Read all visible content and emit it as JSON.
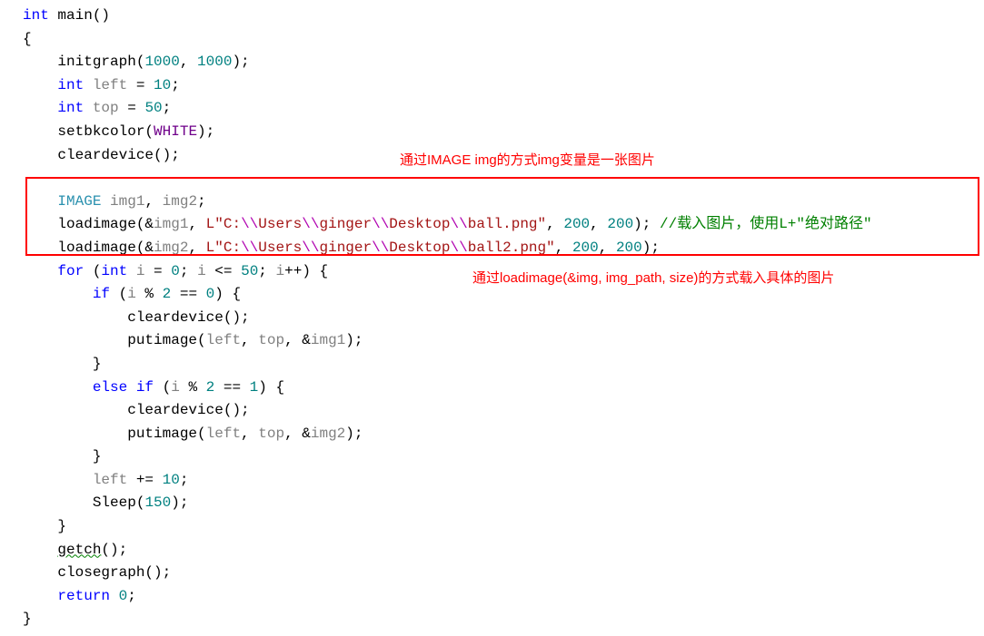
{
  "annotations": {
    "top": "通过IMAGE img的方式img变量是一张图片",
    "bottom": "通过loadimage(&img, img_path, size)的方式载入具体的图片"
  },
  "code": {
    "l1_kw_int": "int",
    "l1_main": " main()",
    "l2_brace": "{",
    "l3_fn": "initgraph",
    "l3_args_a": "(",
    "l3_num1": "1000",
    "l3_comma": ", ",
    "l3_num2": "1000",
    "l3_end": ");",
    "l4_kw": "int",
    "l4_sp": " ",
    "l4_var": "left",
    "l4_eq": " = ",
    "l4_num": "10",
    "l4_end": ";",
    "l5_kw": "int",
    "l5_sp": " ",
    "l5_var": "top",
    "l5_eq": " = ",
    "l5_num": "50",
    "l5_end": ";",
    "l6_fn": "setbkcolor",
    "l6_open": "(",
    "l6_macro": "WHITE",
    "l6_end": ");",
    "l7_fn": "cleardevice",
    "l7_end": "();",
    "l9_type": "IMAGE",
    "l9_sp": " ",
    "l9_v1": "img1",
    "l9_comma": ", ",
    "l9_v2": "img2",
    "l9_end": ";",
    "l10_fn": "loadimage",
    "l10_open": "(&",
    "l10_var": "img1",
    "l10_comma1": ", ",
    "l10_L": "L",
    "l10_q1": "\"C:",
    "l10_esc1": "\\\\",
    "l10_s2": "Users",
    "l10_esc2": "\\\\",
    "l10_s3": "ginger",
    "l10_esc3": "\\\\",
    "l10_s4": "Desktop",
    "l10_esc4": "\\\\",
    "l10_s5": "ball.png\"",
    "l10_comma2": ", ",
    "l10_n1": "200",
    "l10_comma3": ", ",
    "l10_n2": "200",
    "l10_end": "); ",
    "l10_comment": "//载入图片，使用L+\"绝对路径\"",
    "l11_fn": "loadimage",
    "l11_open": "(&",
    "l11_var": "img2",
    "l11_comma1": ", ",
    "l11_L": "L",
    "l11_q1": "\"C:",
    "l11_esc1": "\\\\",
    "l11_s2": "Users",
    "l11_esc2": "\\\\",
    "l11_s3": "ginger",
    "l11_esc3": "\\\\",
    "l11_s4": "Desktop",
    "l11_esc4": "\\\\",
    "l11_s5": "ball2.png\"",
    "l11_comma2": ", ",
    "l11_n1": "200",
    "l11_comma3": ", ",
    "l11_n2": "200",
    "l11_end": ");",
    "l12_for": "for",
    "l12_sp": " (",
    "l12_int": "int",
    "l12_sp2": " ",
    "l12_i": "i",
    "l12_eq": " = ",
    "l12_z": "0",
    "l12_semi": "; ",
    "l12_i2": "i",
    "l12_le": " <= ",
    "l12_50": "50",
    "l12_semi2": "; ",
    "l12_i3": "i",
    "l12_inc": "++) {",
    "l13_if": "if",
    "l13_open": " (",
    "l13_i": "i",
    "l13_mod": " % ",
    "l13_2": "2",
    "l13_eq": " == ",
    "l13_0": "0",
    "l13_end": ") {",
    "l14_fn": "cleardevice",
    "l14_end": "();",
    "l15_fn": "putimage",
    "l15_open": "(",
    "l15_v1": "left",
    "l15_c1": ", ",
    "l15_v2": "top",
    "l15_c2": ", &",
    "l15_v3": "img1",
    "l15_end": ");",
    "l16_brace": "}",
    "l17_else": "else",
    "l17_sp": " ",
    "l17_if": "if",
    "l17_open": " (",
    "l17_i": "i",
    "l17_mod": " % ",
    "l17_2": "2",
    "l17_eq": " == ",
    "l17_1": "1",
    "l17_end": ") {",
    "l18_fn": "cleardevice",
    "l18_end": "();",
    "l19_fn": "putimage",
    "l19_open": "(",
    "l19_v1": "left",
    "l19_c1": ", ",
    "l19_v2": "top",
    "l19_c2": ", &",
    "l19_v3": "img2",
    "l19_end": ");",
    "l20_brace": "}",
    "l21_var": "left",
    "l21_peq": " += ",
    "l21_n": "10",
    "l21_end": ";",
    "l22_fn": "Sleep",
    "l22_open": "(",
    "l22_n": "150",
    "l22_end": ");",
    "l23_brace": "}",
    "l24_fn": "getch",
    "l24_end": "();",
    "l25_fn": "closegraph",
    "l25_end": "();",
    "l26_kw": "return",
    "l26_sp": " ",
    "l26_n": "0",
    "l26_end": ";",
    "l27_brace": "}"
  }
}
